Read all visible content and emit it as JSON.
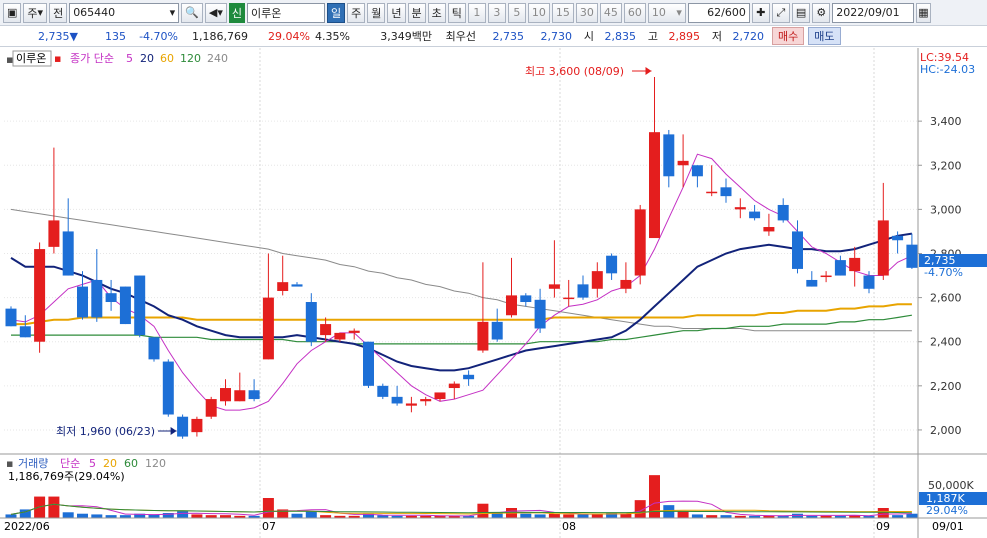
{
  "toolbar": {
    "period_unit": "주",
    "prev_label": "전",
    "code": "065440",
    "badge": "신",
    "name": "이루온",
    "periods": [
      "일",
      "주",
      "월",
      "년",
      "분",
      "초",
      "틱"
    ],
    "active_period": "일",
    "minute_options": [
      "1",
      "3",
      "5",
      "10",
      "15",
      "30",
      "45",
      "60"
    ],
    "count_select": "10",
    "range": "62/600",
    "date": "2022/09/01"
  },
  "quote": {
    "price": "2,735",
    "arrow": "▼",
    "change": "135",
    "change_pct": "-4.70%",
    "volume": "1,186,769",
    "turnover_pct": "29.04%",
    "pct2": "4.35%",
    "amount": "3,349백만",
    "best_bid_label": "최우선",
    "best_ask": "2,735",
    "best_bid": "2,730",
    "open_label": "시",
    "open": "2,835",
    "high_label": "고",
    "high": "2,895",
    "low_label": "저",
    "low": "2,720",
    "buy_label": "매수",
    "sell_label": "매도"
  },
  "price_panel": {
    "stock_tag": "이루온",
    "ma_label": "종가 단순",
    "ma_periods": [
      "5",
      "20",
      "60",
      "120",
      "240"
    ],
    "lc": "LC:39.54",
    "hc": "HC:-24.03",
    "high_annotation": "최고 3,600 (08/09)",
    "low_annotation": "최저 1,960 (06/23)",
    "y_ticks": [
      "3,400",
      "3,200",
      "3,000",
      "2,800",
      "2,600",
      "2,400",
      "2,200",
      "2,000"
    ],
    "current_price": "2,735",
    "current_pct": "-4.70%"
  },
  "volume_panel": {
    "label": "거래량",
    "ma_label": "단순",
    "ma_periods": [
      "5",
      "20",
      "60",
      "120"
    ],
    "summary": "1,186,769주(29.04%)",
    "y_tick": "50,000K",
    "current_volume": "1,187K",
    "current_pct": "29.04%"
  },
  "x_axis": {
    "labels": [
      "2022/06",
      "07",
      "08",
      "09"
    ],
    "right_label": "09/01"
  },
  "colors": {
    "up": "#e41e1e",
    "down": "#1d6fd6",
    "ma5": "#c430c4",
    "ma20": "#12237a",
    "ma60": "#e8a400",
    "ma120": "#2e8b3a",
    "ma240": "#8a8a8a"
  },
  "chart_data": {
    "type": "candlestick",
    "ylim": [
      1900,
      3650
    ],
    "candles": [
      {
        "o": 2550,
        "h": 2560,
        "l": 2470,
        "c": 2470
      },
      {
        "o": 2470,
        "h": 2520,
        "l": 2420,
        "c": 2420
      },
      {
        "o": 2400,
        "h": 2850,
        "l": 2350,
        "c": 2820
      },
      {
        "o": 2830,
        "h": 3280,
        "l": 2800,
        "c": 2950
      },
      {
        "o": 2900,
        "h": 3050,
        "l": 2700,
        "c": 2700
      },
      {
        "o": 2650,
        "h": 2720,
        "l": 2500,
        "c": 2510
      },
      {
        "o": 2680,
        "h": 2820,
        "l": 2490,
        "c": 2510
      },
      {
        "o": 2620,
        "h": 2680,
        "l": 2540,
        "c": 2580
      },
      {
        "o": 2650,
        "h": 2650,
        "l": 2480,
        "c": 2480
      },
      {
        "o": 2700,
        "h": 2700,
        "l": 2420,
        "c": 2430
      },
      {
        "o": 2420,
        "h": 2420,
        "l": 2310,
        "c": 2320
      },
      {
        "o": 2310,
        "h": 2320,
        "l": 2060,
        "c": 2070
      },
      {
        "o": 2060,
        "h": 2070,
        "l": 1960,
        "c": 1970
      },
      {
        "o": 1990,
        "h": 2060,
        "l": 1970,
        "c": 2050
      },
      {
        "o": 2060,
        "h": 2150,
        "l": 2050,
        "c": 2140
      },
      {
        "o": 2130,
        "h": 2230,
        "l": 2110,
        "c": 2190
      },
      {
        "o": 2130,
        "h": 2260,
        "l": 2130,
        "c": 2180
      },
      {
        "o": 2180,
        "h": 2230,
        "l": 2130,
        "c": 2140
      },
      {
        "o": 2320,
        "h": 2800,
        "l": 2320,
        "c": 2600
      },
      {
        "o": 2630,
        "h": 2790,
        "l": 2610,
        "c": 2670
      },
      {
        "o": 2660,
        "h": 2670,
        "l": 2660,
        "c": 2650
      },
      {
        "o": 2580,
        "h": 2620,
        "l": 2380,
        "c": 2400
      },
      {
        "o": 2430,
        "h": 2510,
        "l": 2400,
        "c": 2480
      },
      {
        "o": 2410,
        "h": 2440,
        "l": 2400,
        "c": 2440
      },
      {
        "o": 2440,
        "h": 2460,
        "l": 2410,
        "c": 2450
      },
      {
        "o": 2400,
        "h": 2400,
        "l": 2190,
        "c": 2200
      },
      {
        "o": 2200,
        "h": 2210,
        "l": 2140,
        "c": 2150
      },
      {
        "o": 2150,
        "h": 2200,
        "l": 2110,
        "c": 2120
      },
      {
        "o": 2110,
        "h": 2150,
        "l": 2080,
        "c": 2120
      },
      {
        "o": 2130,
        "h": 2150,
        "l": 2110,
        "c": 2140
      },
      {
        "o": 2140,
        "h": 2160,
        "l": 2130,
        "c": 2170
      },
      {
        "o": 2190,
        "h": 2220,
        "l": 2140,
        "c": 2210
      },
      {
        "o": 2250,
        "h": 2270,
        "l": 2200,
        "c": 2230
      },
      {
        "o": 2360,
        "h": 2760,
        "l": 2350,
        "c": 2490
      },
      {
        "o": 2490,
        "h": 2550,
        "l": 2400,
        "c": 2410
      },
      {
        "o": 2520,
        "h": 2780,
        "l": 2510,
        "c": 2610
      },
      {
        "o": 2610,
        "h": 2620,
        "l": 2560,
        "c": 2580
      },
      {
        "o": 2590,
        "h": 2640,
        "l": 2440,
        "c": 2460
      },
      {
        "o": 2640,
        "h": 2860,
        "l": 2600,
        "c": 2660
      },
      {
        "o": 2600,
        "h": 2680,
        "l": 2560,
        "c": 2600
      },
      {
        "o": 2660,
        "h": 2700,
        "l": 2590,
        "c": 2600
      },
      {
        "o": 2640,
        "h": 2760,
        "l": 2600,
        "c": 2720
      },
      {
        "o": 2790,
        "h": 2800,
        "l": 2680,
        "c": 2710
      },
      {
        "o": 2640,
        "h": 2760,
        "l": 2620,
        "c": 2680
      },
      {
        "o": 2700,
        "h": 3020,
        "l": 2660,
        "c": 3000
      },
      {
        "o": 2870,
        "h": 3600,
        "l": 2870,
        "c": 3350
      },
      {
        "o": 3340,
        "h": 3360,
        "l": 3100,
        "c": 3150
      },
      {
        "o": 3200,
        "h": 3340,
        "l": 3100,
        "c": 3220
      },
      {
        "o": 3200,
        "h": 3200,
        "l": 3100,
        "c": 3150
      },
      {
        "o": 3080,
        "h": 3200,
        "l": 3060,
        "c": 3080
      },
      {
        "o": 3100,
        "h": 3140,
        "l": 3030,
        "c": 3060
      },
      {
        "o": 3000,
        "h": 3050,
        "l": 2960,
        "c": 3010
      },
      {
        "o": 2990,
        "h": 3020,
        "l": 2950,
        "c": 2960
      },
      {
        "o": 2900,
        "h": 2980,
        "l": 2880,
        "c": 2920
      },
      {
        "o": 3020,
        "h": 3050,
        "l": 2940,
        "c": 2950
      },
      {
        "o": 2900,
        "h": 2950,
        "l": 2710,
        "c": 2730
      },
      {
        "o": 2680,
        "h": 2720,
        "l": 2650,
        "c": 2650
      },
      {
        "o": 2700,
        "h": 2720,
        "l": 2670,
        "c": 2700
      },
      {
        "o": 2770,
        "h": 2790,
        "l": 2700,
        "c": 2700
      },
      {
        "o": 2720,
        "h": 2830,
        "l": 2650,
        "c": 2780
      },
      {
        "o": 2700,
        "h": 2720,
        "l": 2620,
        "c": 2640
      },
      {
        "o": 2700,
        "h": 3120,
        "l": 2680,
        "c": 2950
      },
      {
        "o": 2880,
        "h": 2900,
        "l": 2800,
        "c": 2860
      },
      {
        "o": 2840,
        "h": 2890,
        "l": 2730,
        "c": 2735
      }
    ],
    "ma5": [
      2500,
      2490,
      2520,
      2580,
      2640,
      2660,
      2680,
      2600,
      2550,
      2520,
      2470,
      2360,
      2260,
      2180,
      2110,
      2090,
      2090,
      2100,
      2130,
      2210,
      2300,
      2360,
      2400,
      2440,
      2440,
      2380,
      2320,
      2260,
      2200,
      2160,
      2130,
      2140,
      2160,
      2180,
      2250,
      2320,
      2390,
      2470,
      2520,
      2560,
      2570,
      2590,
      2630,
      2650,
      2700,
      2820,
      2960,
      3100,
      3250,
      3230,
      3160,
      3100,
      3040,
      3000,
      2970,
      2900,
      2830,
      2800,
      2760,
      2720,
      2700,
      2700,
      2760,
      2790,
      2800
    ],
    "ma20": [
      2780,
      2740,
      2740,
      2740,
      2720,
      2700,
      2670,
      2640,
      2620,
      2590,
      2560,
      2520,
      2500,
      2470,
      2450,
      2430,
      2420,
      2420,
      2420,
      2420,
      2430,
      2420,
      2410,
      2400,
      2390,
      2370,
      2340,
      2310,
      2290,
      2280,
      2270,
      2270,
      2280,
      2300,
      2320,
      2340,
      2360,
      2370,
      2380,
      2390,
      2400,
      2410,
      2420,
      2450,
      2500,
      2560,
      2620,
      2680,
      2740,
      2770,
      2800,
      2820,
      2830,
      2840,
      2830,
      2820,
      2820,
      2810,
      2810,
      2820,
      2840,
      2860,
      2880,
      2890
    ],
    "ma60": [
      2480,
      2480,
      2490,
      2500,
      2500,
      2510,
      2510,
      2510,
      2510,
      2510,
      2510,
      2510,
      2510,
      2500,
      2500,
      2500,
      2500,
      2500,
      2500,
      2500,
      2500,
      2500,
      2500,
      2500,
      2500,
      2500,
      2500,
      2500,
      2500,
      2500,
      2500,
      2500,
      2500,
      2500,
      2500,
      2500,
      2500,
      2500,
      2510,
      2510,
      2510,
      2510,
      2510,
      2510,
      2510,
      2510,
      2510,
      2510,
      2520,
      2520,
      2520,
      2520,
      2520,
      2530,
      2530,
      2540,
      2540,
      2540,
      2550,
      2550,
      2560,
      2560,
      2570,
      2570
    ],
    "ma120": [
      2430,
      2430,
      2430,
      2430,
      2430,
      2430,
      2430,
      2430,
      2430,
      2430,
      2420,
      2420,
      2420,
      2420,
      2410,
      2410,
      2410,
      2410,
      2410,
      2410,
      2400,
      2400,
      2400,
      2400,
      2390,
      2390,
      2390,
      2390,
      2390,
      2390,
      2390,
      2390,
      2390,
      2390,
      2390,
      2390,
      2390,
      2400,
      2400,
      2400,
      2400,
      2400,
      2410,
      2410,
      2420,
      2430,
      2440,
      2450,
      2450,
      2460,
      2460,
      2470,
      2470,
      2470,
      2480,
      2480,
      2480,
      2480,
      2490,
      2490,
      2500,
      2500,
      2510,
      2520
    ],
    "ma240": [
      3000,
      2990,
      2980,
      2970,
      2960,
      2950,
      2940,
      2930,
      2920,
      2910,
      2900,
      2890,
      2880,
      2870,
      2860,
      2850,
      2840,
      2830,
      2820,
      2800,
      2790,
      2780,
      2770,
      2750,
      2740,
      2720,
      2710,
      2690,
      2680,
      2660,
      2650,
      2630,
      2620,
      2600,
      2590,
      2570,
      2560,
      2550,
      2540,
      2530,
      2520,
      2510,
      2500,
      2490,
      2480,
      2470,
      2470,
      2460,
      2460,
      2460,
      2460,
      2460,
      2450,
      2450,
      2450,
      2450,
      2450,
      2450,
      2450,
      2450,
      2450,
      2450,
      2450,
      2450
    ],
    "volumes": [
      5,
      12,
      30,
      30,
      8,
      6,
      5,
      4,
      4,
      6,
      5,
      7,
      10,
      5,
      4,
      4,
      3,
      3,
      28,
      12,
      6,
      9,
      4,
      3,
      3,
      6,
      4,
      3,
      3,
      3,
      3,
      3,
      3,
      20,
      8,
      14,
      6,
      5,
      6,
      5,
      5,
      6,
      7,
      6,
      25,
      60,
      18,
      9,
      5,
      4,
      4,
      3,
      3,
      3,
      3,
      6,
      3,
      3,
      3,
      4,
      3,
      14,
      4,
      6
    ]
  }
}
